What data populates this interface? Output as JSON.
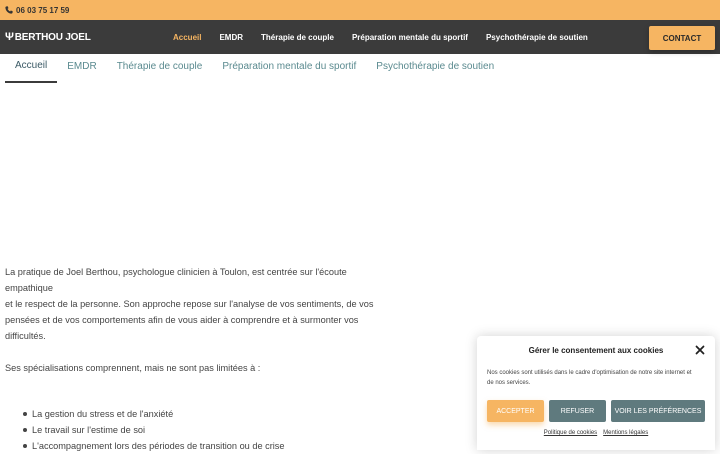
{
  "topbar": {
    "phone": "06 03 75 17 59",
    "phone_icon": "phone-icon"
  },
  "header": {
    "logo_symbol": "Ψ",
    "logo_text": "BERTHOU JOEL",
    "nav": [
      "Accueil",
      "EMDR",
      "Thérapie de couple",
      "Préparation mentale du sportif",
      "Psychothérapie de soutien"
    ],
    "active_nav": "Accueil",
    "contact_label": "CONTACT"
  },
  "tabs": [
    "Accueil",
    "EMDR",
    "Thérapie de couple",
    "Préparation mentale du sportif",
    "Psychothérapie de soutien"
  ],
  "active_tab": "Accueil",
  "main": {
    "intro_line1": "La pratique de Joel Berthou, psychologue clinicien à Toulon, est centrée sur l'écoute empathique",
    "intro_line2": "et le respect de la personne. Son approche repose sur l'analyse de vos sentiments, de vos",
    "intro_line3": "pensées et de vos comportements afin de vous aider à comprendre et à surmonter vos",
    "intro_line4": "difficultés.",
    "spec_intro": "Ses spécialisations comprennent, mais ne sont pas limitées à :",
    "specializations": [
      "La gestion du stress et de l'anxiété",
      "Le travail sur l'estime de soi",
      "L'accompagnement lors des périodes de transition ou de crise"
    ]
  },
  "cookie": {
    "title": "Gérer le consentement aux cookies",
    "text": "Nos cookies sont utilisés dans le cadre d'optimisation de notre site internet et de nos services.",
    "accept_label": "ACCEPTER",
    "refuse_label": "REFUSER",
    "prefs_label": "VOIR LES PRÉFÉRENCES",
    "policy_link": "Politique de cookies",
    "legal_link": "Mentions légales"
  },
  "colors": {
    "accent": "#f6b562",
    "header_bg": "#3b3b3b",
    "secondary_btn": "#5f7a7e"
  }
}
